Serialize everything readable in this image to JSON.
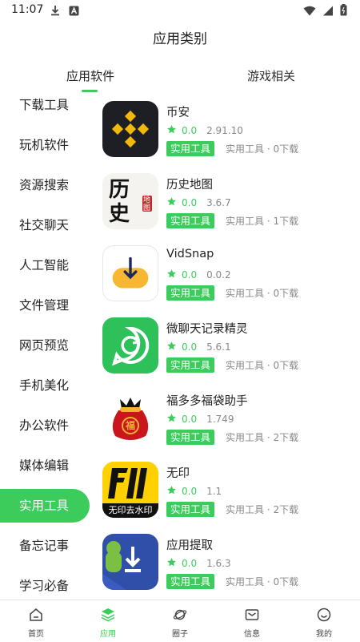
{
  "status_bar": {
    "time": "11:07"
  },
  "header": {
    "title": "应用类别"
  },
  "tabs": [
    {
      "label": "应用软件",
      "active": true
    },
    {
      "label": "游戏相关",
      "active": false
    }
  ],
  "sidebar": {
    "items": [
      {
        "label": "下载工具"
      },
      {
        "label": "玩机软件"
      },
      {
        "label": "资源搜索"
      },
      {
        "label": "社交聊天"
      },
      {
        "label": "人工智能"
      },
      {
        "label": "文件管理"
      },
      {
        "label": "网页预览"
      },
      {
        "label": "手机美化"
      },
      {
        "label": "办公软件"
      },
      {
        "label": "媒体编辑"
      },
      {
        "label": "实用工具",
        "active": true
      },
      {
        "label": "备忘记事"
      },
      {
        "label": "学习必备"
      }
    ]
  },
  "apps": [
    {
      "name": "币安",
      "rating": "0.0",
      "version": "2.91.10",
      "tag": "实用工具",
      "info": "实用工具 · 0下载",
      "icon": "binance-icon"
    },
    {
      "name": "历史地图",
      "rating": "0.0",
      "version": "3.6.7",
      "tag": "实用工具",
      "info": "实用工具 · 1下载",
      "icon": "history-map-icon",
      "icon_text": "历史",
      "stamp_text": "地图"
    },
    {
      "name": "VidSnap",
      "rating": "0.0",
      "version": "0.0.2",
      "tag": "实用工具",
      "info": "实用工具 · 0下载",
      "icon": "download-arrow-icon"
    },
    {
      "name": "微聊天记录精灵",
      "rating": "0.0",
      "version": "5.6.1",
      "tag": "实用工具",
      "info": "实用工具 · 0下载",
      "icon": "chat-restore-icon"
    },
    {
      "name": "福多多福袋助手",
      "rating": "0.0",
      "version": "1.749",
      "tag": "实用工具",
      "info": "实用工具 · 2下载",
      "icon": "lucky-bag-icon",
      "icon_text": "福"
    },
    {
      "name": "无印",
      "rating": "0.0",
      "version": "1.1",
      "tag": "实用工具",
      "info": "实用工具 · 2下载",
      "icon": "watermark-remover-icon",
      "icon_text": "无印去水印"
    },
    {
      "name": "应用提取",
      "rating": "0.0",
      "version": "1.6.3",
      "tag": "实用工具",
      "info": "实用工具 · 0下载",
      "icon": "app-extract-icon"
    }
  ],
  "bottom_nav": [
    {
      "label": "首页",
      "icon": "home-icon"
    },
    {
      "label": "应用",
      "icon": "apps-icon",
      "active": true
    },
    {
      "label": "圈子",
      "icon": "planet-icon"
    },
    {
      "label": "信息",
      "icon": "message-icon"
    },
    {
      "label": "我的",
      "icon": "smile-icon"
    }
  ],
  "colors": {
    "accent": "#3ccc5c",
    "text": "#222222",
    "muted": "#888888"
  }
}
